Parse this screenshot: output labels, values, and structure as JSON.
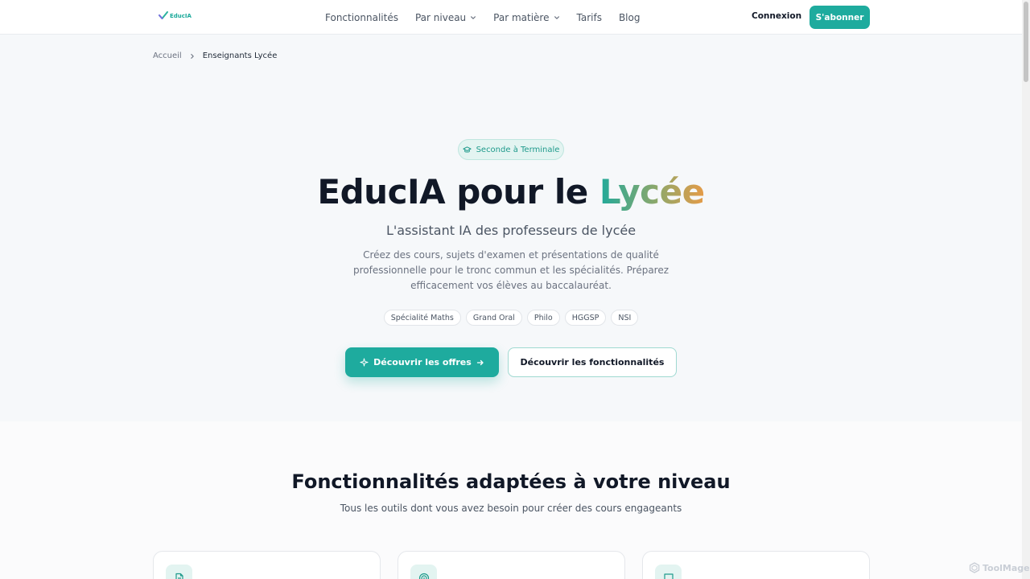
{
  "header": {
    "logo_text": "EducIA",
    "nav": [
      {
        "label": "Fonctionnalités",
        "dropdown": false
      },
      {
        "label": "Par niveau",
        "dropdown": true
      },
      {
        "label": "Par matière",
        "dropdown": true
      },
      {
        "label": "Tarifs",
        "dropdown": false
      },
      {
        "label": "Blog",
        "dropdown": false
      }
    ],
    "login_label": "Connexion",
    "subscribe_label": "S'abonner"
  },
  "breadcrumb": {
    "home": "Accueil",
    "current": "Enseignants Lycée"
  },
  "hero": {
    "badge": "Seconde à Terminale",
    "title_main": "EducIA pour le ",
    "title_accent": "Lycée",
    "subtitle": "L'assistant IA des professeurs de lycée",
    "description": "Créez des cours, sujets d'examen et présentations de qualité professionnelle pour le tronc commun et les spécialités. Préparez efficacement vos élèves au baccalauréat.",
    "tags": [
      "Spécialité Maths",
      "Grand Oral",
      "Philo",
      "HGGSP",
      "NSI"
    ],
    "cta_primary": "Découvrir les offres",
    "cta_secondary": "Découvrir les fonctionnalités"
  },
  "features": {
    "title": "Fonctionnalités adaptées à votre niveau",
    "subtitle": "Tous les outils dont vous avez besoin pour créer des cours engageants",
    "card_icons": [
      "document-icon",
      "target-icon",
      "presentation-icon"
    ]
  },
  "watermark": "ToolMage",
  "colors": {
    "primary": "#1eab9e",
    "accent_start": "#21a99a",
    "accent_end": "#e69b47"
  }
}
